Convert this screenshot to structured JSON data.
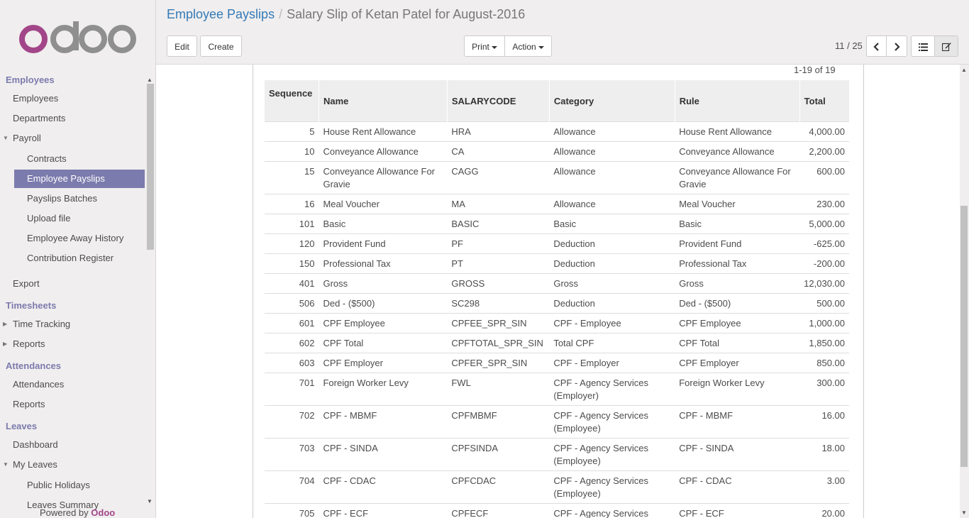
{
  "brand": {
    "logo_text": "odoo",
    "powered_prefix": "Powered by",
    "powered_brand": "Odoo",
    "color": "#a24689"
  },
  "breadcrumb": {
    "parent": "Employee Payslips",
    "current": "Salary Slip of Ketan Patel for August-2016"
  },
  "toolbar": {
    "edit": "Edit",
    "create": "Create",
    "print": "Print",
    "action": "Action"
  },
  "pager": {
    "value": "11 / 25"
  },
  "sidebar": {
    "sections": [
      "Employees",
      "Timesheets",
      "Attendances",
      "Leaves"
    ],
    "items": [
      "Employees",
      "Departments",
      "Payroll",
      "Contracts",
      "Employee Payslips",
      "Payslips Batches",
      "Upload file",
      "Employee Away History",
      "Contribution Register",
      "Export",
      "Time Tracking",
      "Reports",
      "Attendances",
      "Reports",
      "Dashboard",
      "My Leaves",
      "Public Holidays",
      "Leaves Summary"
    ],
    "active": "Employee Payslips"
  },
  "list": {
    "count": "1-19 of 19",
    "headers": [
      "Sequence",
      "Name",
      "SALARYCODE",
      "Category",
      "Rule",
      "Total"
    ],
    "rows": [
      [
        "5",
        "House Rent Allowance",
        "HRA",
        "Allowance",
        "House Rent Allowance",
        "4,000.00"
      ],
      [
        "10",
        "Conveyance Allowance",
        "CA",
        "Allowance",
        "Conveyance Allowance",
        "2,200.00"
      ],
      [
        "15",
        "Conveyance Allowance For Gravie",
        "CAGG",
        "Allowance",
        "Conveyance Allowance For Gravie",
        "600.00"
      ],
      [
        "16",
        "Meal Voucher",
        "MA",
        "Allowance",
        "Meal Voucher",
        "230.00"
      ],
      [
        "101",
        "Basic",
        "BASIC",
        "Basic",
        "Basic",
        "5,000.00"
      ],
      [
        "120",
        "Provident Fund",
        "PF",
        "Deduction",
        "Provident Fund",
        "-625.00"
      ],
      [
        "150",
        "Professional Tax",
        "PT",
        "Deduction",
        "Professional Tax",
        "-200.00"
      ],
      [
        "401",
        "Gross",
        "GROSS",
        "Gross",
        "Gross",
        "12,030.00"
      ],
      [
        "506",
        "Ded - ($500)",
        "SC298",
        "Deduction",
        "Ded - ($500)",
        "500.00"
      ],
      [
        "601",
        "CPF Employee",
        "CPFEE_SPR_SIN",
        "CPF - Employee",
        "CPF Employee",
        "1,000.00"
      ],
      [
        "602",
        "CPF Total",
        "CPFTOTAL_SPR_SIN",
        "Total CPF",
        "CPF Total",
        "1,850.00"
      ],
      [
        "603",
        "CPF Employer",
        "CPFER_SPR_SIN",
        "CPF - Employer",
        "CPF Employer",
        "850.00"
      ],
      [
        "701",
        "Foreign Worker Levy",
        "FWL",
        "CPF - Agency Services (Employer)",
        "Foreign Worker Levy",
        "300.00"
      ],
      [
        "702",
        "CPF - MBMF",
        "CPFMBMF",
        "CPF - Agency Services (Employee)",
        "CPF - MBMF",
        "16.00"
      ],
      [
        "703",
        "CPF - SINDA",
        "CPFSINDA",
        "CPF - Agency Services (Employee)",
        "CPF - SINDA",
        "18.00"
      ],
      [
        "704",
        "CPF - CDAC",
        "CPFCDAC",
        "CPF - Agency Services (Employee)",
        "CPF - CDAC",
        "3.00"
      ],
      [
        "705",
        "CPF - ECF",
        "CPFECF",
        "CPF - Agency Services (Employee)",
        "CPF - ECF",
        "20.00"
      ]
    ]
  }
}
